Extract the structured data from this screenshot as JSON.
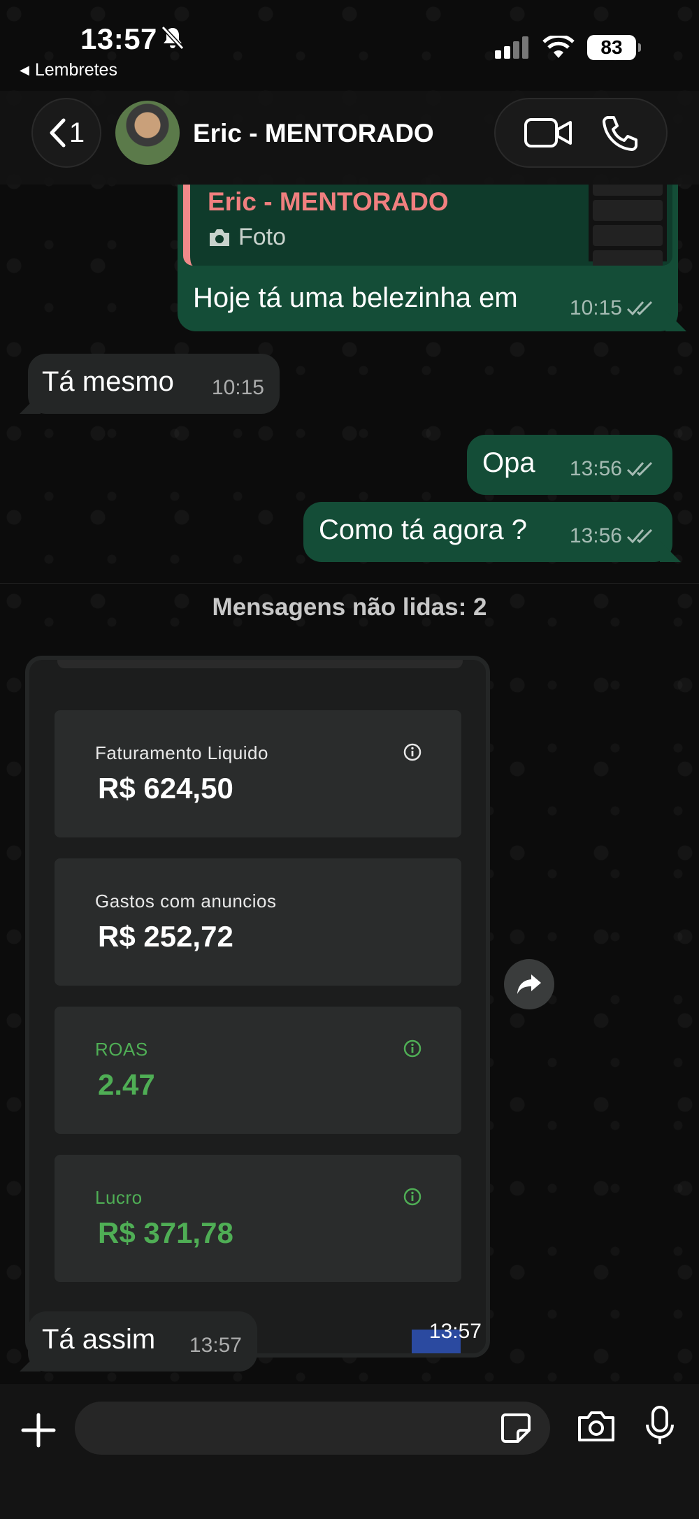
{
  "status_bar": {
    "time": "13:57",
    "back_app": "Lembretes",
    "battery": "83"
  },
  "header": {
    "back_count": "1",
    "contact_name": "Eric - MENTORADO"
  },
  "messages": [
    {
      "direction": "out",
      "quote": {
        "name": "Eric - MENTORADO",
        "type": "Foto"
      },
      "text": "Hoje tá uma belezinha em",
      "time": "10:15",
      "read": true
    },
    {
      "direction": "in",
      "text": "Tá mesmo",
      "time": "10:15"
    },
    {
      "direction": "out",
      "text": "Opa",
      "time": "13:56",
      "read": true
    },
    {
      "direction": "out",
      "text": "Como tá agora ?",
      "time": "13:56",
      "read": true
    },
    {
      "direction": "in",
      "text": "Tá assim",
      "time": "13:57"
    }
  ],
  "unread_divider": "Mensagens não lidas: 2",
  "image_message": {
    "time": "13:57",
    "cards": [
      {
        "label": "Faturamento Liquido",
        "value": "R$ 624,50",
        "color": "#ffffff",
        "info_icon": true
      },
      {
        "label": "Gastos com anuncios",
        "value": "R$ 252,72",
        "color": "#ffffff",
        "info_icon": false
      },
      {
        "label": "ROAS",
        "value": "2.47",
        "color": "#4fae55",
        "info_icon": true
      },
      {
        "label": "Lucro",
        "value": "R$ 371,78",
        "color": "#4fae55",
        "info_icon": true
      }
    ]
  },
  "composer": {
    "placeholder": ""
  },
  "colors": {
    "outgoing_bubble": "#144d37",
    "incoming_bubble": "#242626",
    "quote_name": "#f07f7f",
    "accent_green": "#4fae55"
  }
}
